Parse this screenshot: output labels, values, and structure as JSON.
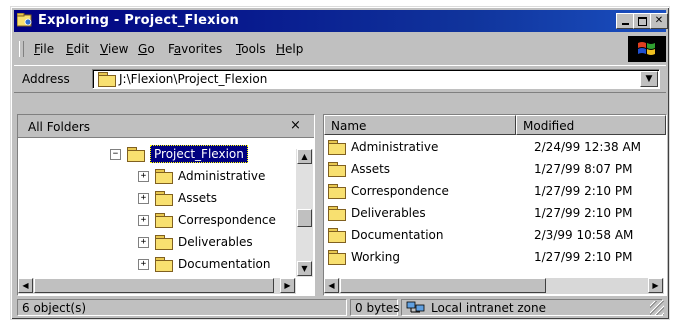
{
  "window": {
    "title": "Exploring - Project_Flexion",
    "controls": [
      "minimize-icon",
      "maximize-icon",
      "close-icon"
    ]
  },
  "menu": {
    "items": [
      {
        "underline": "F",
        "rest": "ile"
      },
      {
        "underline": "E",
        "rest": "dit"
      },
      {
        "underline": "V",
        "rest": "iew"
      },
      {
        "underline": "G",
        "rest": "o"
      },
      {
        "pre": "F",
        "underline": "a",
        "rest": "vorites"
      },
      {
        "underline": "T",
        "rest": "ools"
      },
      {
        "underline": "H",
        "rest": "elp"
      }
    ]
  },
  "address": {
    "label": "Address",
    "value": "J:\\Flexion\\Project_Flexion"
  },
  "folders_pane": {
    "header": "All Folders",
    "close": "×",
    "tree": {
      "selected": "Project_Flexion",
      "expander_selected": "−",
      "children": [
        "Administrative",
        "Assets",
        "Correspondence",
        "Deliverables",
        "Documentation"
      ],
      "expander_child": "+"
    }
  },
  "list_pane": {
    "columns": [
      "Name",
      "Modified"
    ],
    "rows": [
      {
        "name": "Administrative",
        "modified": "2/24/99 12:38 AM"
      },
      {
        "name": "Assets",
        "modified": "1/27/99 8:07 PM"
      },
      {
        "name": "Correspondence",
        "modified": "1/27/99 2:10 PM"
      },
      {
        "name": "Deliverables",
        "modified": "1/27/99 2:10 PM"
      },
      {
        "name": "Documentation",
        "modified": "2/3/99 10:58 AM"
      },
      {
        "name": "Working",
        "modified": "1/27/99 2:10 PM"
      }
    ]
  },
  "status": {
    "objects": "6 object(s)",
    "size": "0 bytes",
    "zone": "Local intranet zone"
  },
  "colors": {
    "titlebar": "#000080",
    "selection": "#000080",
    "folder": "#f8e070",
    "face": "#c0c0c0"
  }
}
